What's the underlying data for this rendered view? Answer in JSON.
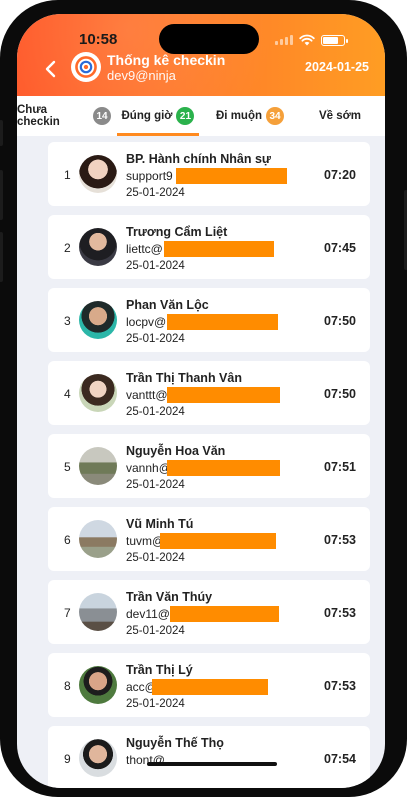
{
  "status": {
    "time": "10:58"
  },
  "header": {
    "back_icon": "chevron-left-icon",
    "title": "Thống kê checkin",
    "subtitle": "dev9@ninja",
    "date": "2024-01-25",
    "gradient_colors": [
      "#ff5a2a",
      "#ff9d23"
    ]
  },
  "tabs": [
    {
      "label": "Chưa checkin",
      "count": "14",
      "badge_color": "#8a8a8a",
      "active": false
    },
    {
      "label": "Đúng giờ",
      "count": "21",
      "badge_color": "#2bb24c",
      "active": true
    },
    {
      "label": "Đi muộn",
      "count": "34",
      "badge_color": "#f5a03a",
      "active": false
    },
    {
      "label": "Về sớm",
      "count": "",
      "badge_color": "",
      "active": false
    }
  ],
  "entries": [
    {
      "index": "1",
      "name": "BP. Hành chính Nhân sự",
      "email": "support9",
      "date": "25-01-2024",
      "time": "07:20"
    },
    {
      "index": "2",
      "name": "Trương Cẩm Liệt",
      "email": "liettc@",
      "date": "25-01-2024",
      "time": "07:45"
    },
    {
      "index": "3",
      "name": "Phan Văn Lộc",
      "email": "locpv@",
      "date": "25-01-2024",
      "time": "07:50"
    },
    {
      "index": "4",
      "name": "Trần Thị Thanh Vân",
      "email": "vanttt@",
      "date": "25-01-2024",
      "time": "07:50"
    },
    {
      "index": "5",
      "name": "Nguyễn Hoa Văn",
      "email": "vannh@",
      "date": "25-01-2024",
      "time": "07:51"
    },
    {
      "index": "6",
      "name": "Vũ Minh Tú",
      "email": "tuvm@",
      "date": "25-01-2024",
      "time": "07:53"
    },
    {
      "index": "7",
      "name": "Trần Văn Thúy",
      "email": "dev11@",
      "date": "25-01-2024",
      "time": "07:53"
    },
    {
      "index": "8",
      "name": "Trần Thị Lý",
      "email": "acc@",
      "date": "25-01-2024",
      "time": "07:53"
    },
    {
      "index": "9",
      "name": "Nguyễn Thế Thọ",
      "email": "thont@",
      "date": "",
      "time": "07:54"
    }
  ],
  "redaction_color": "#ff8c00"
}
